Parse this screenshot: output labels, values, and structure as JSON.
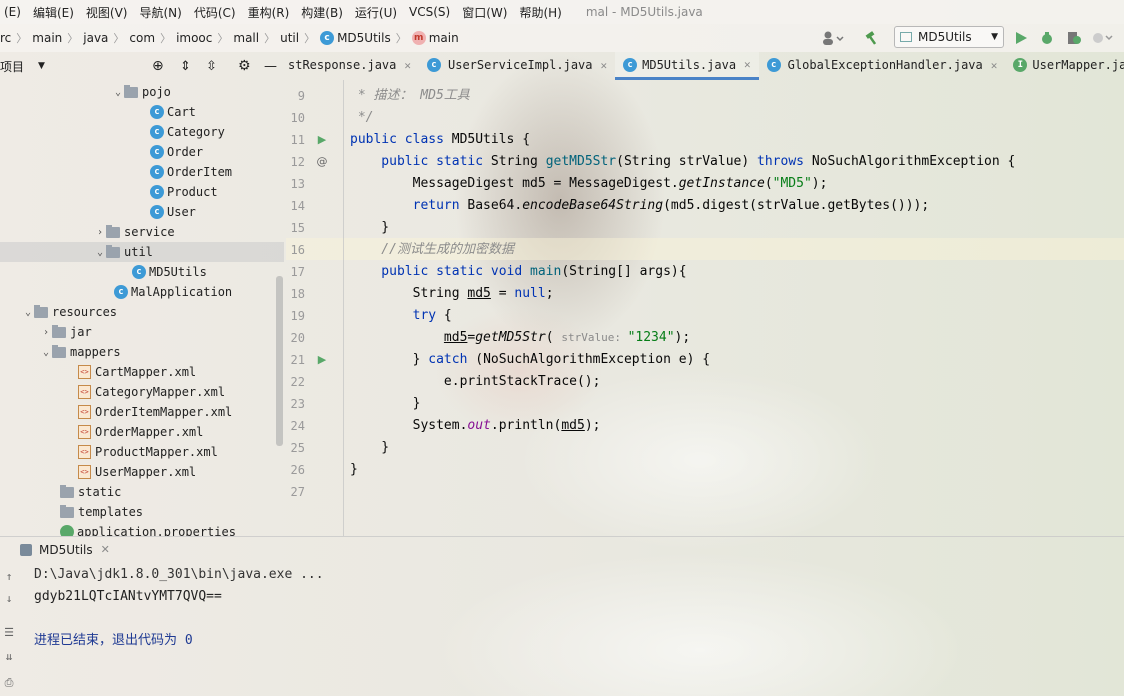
{
  "menu": {
    "items": [
      "(E)",
      "编辑(E)",
      "视图(V)",
      "导航(N)",
      "代码(C)",
      "重构(R)",
      "构建(B)",
      "运行(U)",
      "VCS(S)",
      "窗口(W)",
      "帮助(H)"
    ],
    "title": "mal - MD5Utils.java"
  },
  "breadcrumb": [
    "rc",
    "main",
    "java",
    "com",
    "imooc",
    "mall",
    "util",
    "MD5Utils",
    "main"
  ],
  "run_config": "MD5Utils",
  "project_panel": {
    "title": "项目"
  },
  "tree": [
    {
      "label": "pojo",
      "kind": "folder",
      "arrow": "⌄",
      "expanded": true
    },
    {
      "label": "Cart",
      "kind": "class"
    },
    {
      "label": "Category",
      "kind": "class"
    },
    {
      "label": "Order",
      "kind": "class"
    },
    {
      "label": "OrderItem",
      "kind": "class"
    },
    {
      "label": "Product",
      "kind": "class"
    },
    {
      "label": "User",
      "kind": "class"
    },
    {
      "label": "service",
      "kind": "folder",
      "arrow": "›"
    },
    {
      "label": "util",
      "kind": "folder",
      "arrow": "⌄",
      "selected": true
    },
    {
      "label": "MD5Utils",
      "kind": "class"
    },
    {
      "label": "MalApplication",
      "kind": "class"
    },
    {
      "label": "resources",
      "kind": "folder",
      "arrow": "⌄"
    },
    {
      "label": "jar",
      "kind": "folder",
      "arrow": "›"
    },
    {
      "label": "mappers",
      "kind": "folder",
      "arrow": "⌄"
    },
    {
      "label": "CartMapper.xml",
      "kind": "xml"
    },
    {
      "label": "CategoryMapper.xml",
      "kind": "xml"
    },
    {
      "label": "OrderItemMapper.xml",
      "kind": "xml"
    },
    {
      "label": "OrderMapper.xml",
      "kind": "xml"
    },
    {
      "label": "ProductMapper.xml",
      "kind": "xml"
    },
    {
      "label": "UserMapper.xml",
      "kind": "xml"
    },
    {
      "label": "static",
      "kind": "folder"
    },
    {
      "label": "templates",
      "kind": "folder"
    },
    {
      "label": "application.properties",
      "kind": "props"
    }
  ],
  "tabs": [
    {
      "label": "stResponse.java",
      "icon": ""
    },
    {
      "label": "UserServiceImpl.java",
      "icon": "c"
    },
    {
      "label": "MD5Utils.java",
      "icon": "c",
      "active": true
    },
    {
      "label": "GlobalExceptionHandler.java",
      "icon": "c"
    },
    {
      "label": "UserMapper.java",
      "icon": "i"
    }
  ],
  "line_numbers": [
    "9",
    "10",
    "11",
    "12",
    "13",
    "14",
    "15",
    "16",
    "17",
    "18",
    "19",
    "20",
    "21",
    "22",
    "23",
    "24",
    "25",
    "26",
    "27"
  ],
  "code": {
    "l9": " * 描述： MD5工具",
    "l10": " */",
    "l11a": "public class ",
    "l11b": "MD5Utils {",
    "l12a": "    public static ",
    "l12b": "String ",
    "l12c": "getMD5Str",
    "l12d": "(String strValue) ",
    "l12e": "throws ",
    "l12f": "NoSuchAlgorithmException {",
    "l13a": "        MessageDigest md5 = MessageDigest.",
    "l13b": "getInstance",
    "l13c": "(",
    "l13d": "\"MD5\"",
    "l13e": ");",
    "l14a": "        return ",
    "l14b": "Base64.",
    "l14c": "encodeBase64String",
    "l14d": "(md5.digest(strValue.getBytes()));",
    "l15": "    }",
    "l16": "    //测试生成的加密数据",
    "l17a": "    public static void ",
    "l17b": "main",
    "l17c": "(String[] args){",
    "l18a": "        String ",
    "l18b": "md5",
    "l18c": " = ",
    "l18d": "null",
    "l18e": ";",
    "l19a": "        try ",
    "l19b": "{",
    "l20a": "            ",
    "l20b": "md5",
    "l20c": "=",
    "l20d": "getMD5Str",
    "l20e": "( ",
    "l20hint": "strValue: ",
    "l20f": "\"1234\"",
    "l20g": ");",
    "l21a": "        } ",
    "l21b": "catch ",
    "l21c": "(NoSuchAlgorithmException e) {",
    "l22": "            e.printStackTrace();",
    "l23": "        }",
    "l24a": "        System.",
    "l24b": "out",
    "l24c": ".println(",
    "l24d": "md5",
    "l24e": ");",
    "l25": "    }",
    "l26": "}"
  },
  "run_panel": {
    "tab": "MD5Utils"
  },
  "console": {
    "line1": "D:\\Java\\jdk1.8.0_301\\bin\\java.exe ...",
    "line2": "gdyb21LQTcIANtvYMT7QVQ==",
    "line3": "进程已结束，退出代码为 0"
  },
  "colors": {
    "keyword": "#0033b3",
    "string": "#067d17",
    "comment": "#8c8c8c",
    "accent": "#4a83c7"
  }
}
